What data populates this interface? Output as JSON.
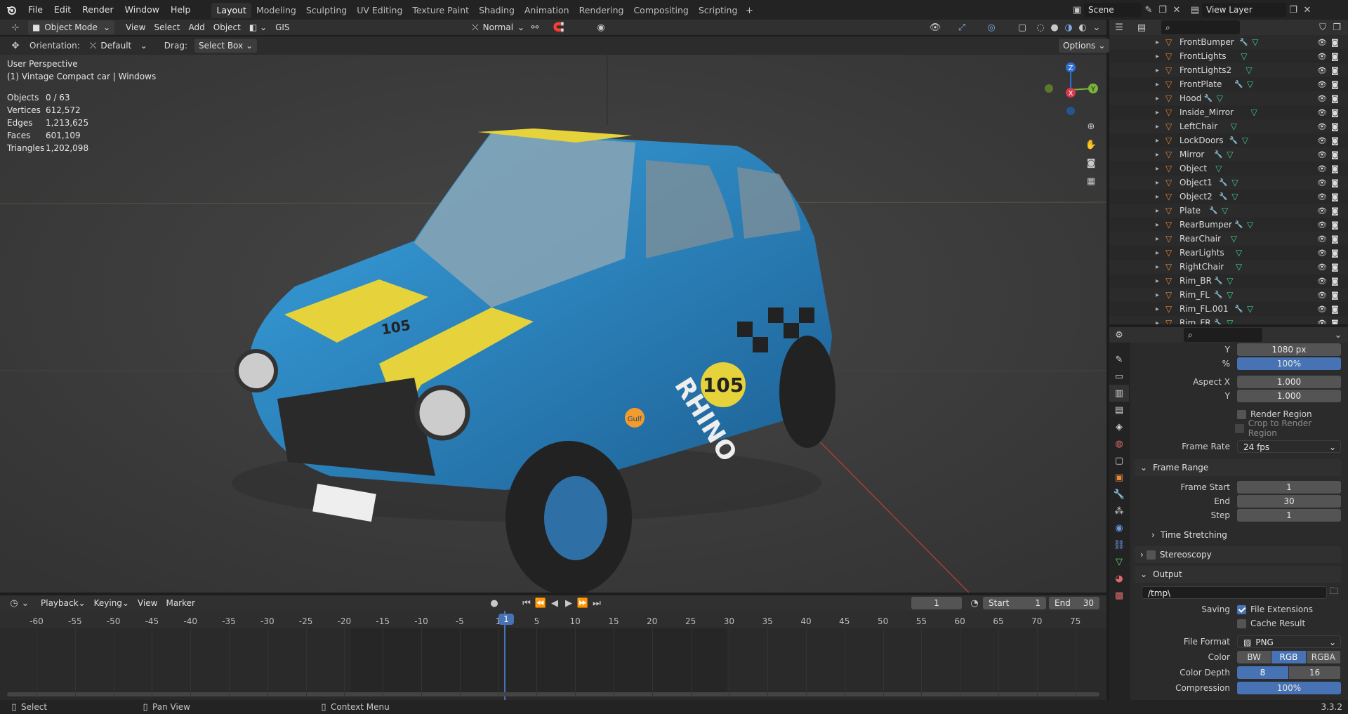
{
  "app": {
    "version": "3.3.2"
  },
  "topbar": {
    "menus": [
      "File",
      "Edit",
      "Render",
      "Window",
      "Help"
    ],
    "workspaces": [
      "Layout",
      "Modeling",
      "Sculpting",
      "UV Editing",
      "Texture Paint",
      "Shading",
      "Animation",
      "Rendering",
      "Compositing",
      "Scripting"
    ],
    "active_workspace": "Layout",
    "scene_name": "Scene",
    "view_layer": "View Layer"
  },
  "viewport_header": {
    "mode": "Object Mode",
    "menus": [
      "View",
      "Select",
      "Add",
      "Object"
    ],
    "gis": "GIS",
    "transform_orientation": "Normal"
  },
  "tool_settings": {
    "orientation_label": "Orientation:",
    "orientation_value": "Default",
    "drag_label": "Drag:",
    "drag_value": "Select Box",
    "options": "Options"
  },
  "viewport": {
    "perspective": "User Perspective",
    "object_info": "(1) Vintage Compact car | Windows",
    "stats": [
      {
        "key": "Objects",
        "value": "0 / 63"
      },
      {
        "key": "Vertices",
        "value": "612,572"
      },
      {
        "key": "Edges",
        "value": "1,213,625"
      },
      {
        "key": "Faces",
        "value": "601,109"
      },
      {
        "key": "Triangles",
        "value": "1,202,098"
      }
    ],
    "gizmo": {
      "z": "Z",
      "y": "Y",
      "x": "X"
    },
    "car_text": {
      "number": "105",
      "brand": "RHINO",
      "sponsor": "Gulf"
    }
  },
  "outliner": {
    "items": [
      "FrontBumper",
      "FrontLights",
      "FrontLights2",
      "FrontPlate",
      "Hood",
      "Inside_Mirror",
      "LeftChair",
      "LockDoors",
      "Mirror",
      "Object",
      "Object1",
      "Object2",
      "Plate",
      "RearBumper",
      "RearChair",
      "RearLights",
      "RightChair",
      "Rim_BR",
      "Rim_FL",
      "Rim_FL.001",
      "Rim_FR"
    ],
    "with_modifier": [
      true,
      false,
      false,
      true,
      true,
      false,
      false,
      true,
      true,
      false,
      true,
      true,
      true,
      true,
      false,
      false,
      false,
      true,
      true,
      true,
      true
    ]
  },
  "properties": {
    "res_y_label": "Y",
    "res_y": "1080 px",
    "pct_label": "%",
    "pct": "100%",
    "aspect_x_label": "Aspect X",
    "aspect_x": "1.000",
    "aspect_y_label": "Y",
    "aspect_y": "1.000",
    "render_region": "Render Region",
    "crop_region": "Crop to Render Region",
    "frame_rate_label": "Frame Rate",
    "frame_rate": "24 fps",
    "frame_range": "Frame Range",
    "frame_start_label": "Frame Start",
    "frame_start": "1",
    "end_label": "End",
    "end": "30",
    "step_label": "Step",
    "step": "1",
    "time_stretching": "Time Stretching",
    "stereoscopy": "Stereoscopy",
    "output": "Output",
    "output_path": "/tmp\\",
    "saving_label": "Saving",
    "file_extensions": "File Extensions",
    "cache_result": "Cache Result",
    "file_format_label": "File Format",
    "file_format": "PNG",
    "color_label": "Color",
    "color_modes": [
      "BW",
      "RGB",
      "RGBA"
    ],
    "color_active": "RGB",
    "depth_label": "Color Depth",
    "depth_modes": [
      "8",
      "16"
    ],
    "depth_active": "8",
    "compression_label": "Compression",
    "compression": "100%"
  },
  "timeline": {
    "menus": [
      "Playback",
      "Keying",
      "View",
      "Marker"
    ],
    "current_frame": "1",
    "start_label": "Start",
    "start": "1",
    "end_label": "End",
    "end": "30",
    "ticks": [
      "-60",
      "-55",
      "-50",
      "-45",
      "-40",
      "-35",
      "-30",
      "-25",
      "-20",
      "-15",
      "-10",
      "-5",
      "1",
      "5",
      "10",
      "15",
      "20",
      "25",
      "30",
      "35",
      "40",
      "45",
      "50",
      "55",
      "60",
      "65",
      "70",
      "75"
    ]
  },
  "statusbar": {
    "select": "Select",
    "pan": "Pan View",
    "context": "Context Menu"
  }
}
